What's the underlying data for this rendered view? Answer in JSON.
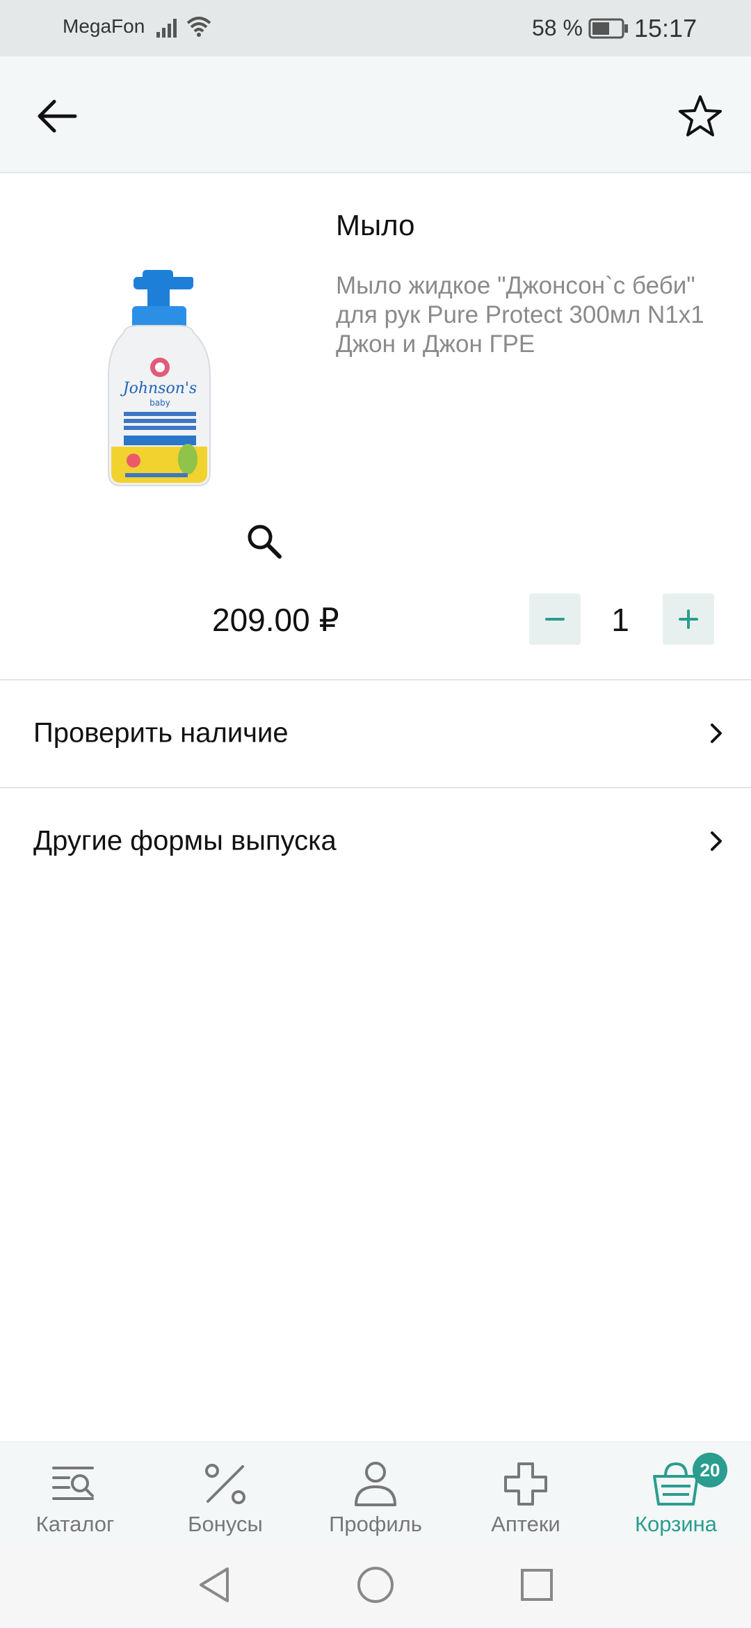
{
  "status_bar": {
    "carrier": "MegaFon",
    "battery_percent": "58 %",
    "time": "15:17"
  },
  "app_bar": {
    "back_icon": "arrow-left-icon",
    "favorite_icon": "star-outline-icon"
  },
  "product": {
    "title": "Мыло",
    "description": "Мыло жидкое \"Джонсон`с беби\" для рук Pure Protect 300мл N1x1 Джон и Джон ГРЕ",
    "image_icon": "product-bottle-image",
    "zoom_icon": "magnifier-icon",
    "price": "209.00 ₽",
    "quantity": "1",
    "minus_label": "−",
    "plus_label": "+"
  },
  "rows": [
    {
      "label": "Проверить наличие"
    },
    {
      "label": "Другие формы выпуска"
    }
  ],
  "bottom_nav": {
    "items": [
      {
        "label": "Каталог",
        "icon": "catalog-icon"
      },
      {
        "label": "Бонусы",
        "icon": "percent-icon"
      },
      {
        "label": "Профиль",
        "icon": "person-icon"
      },
      {
        "label": "Аптеки",
        "icon": "pharmacy-cross-icon"
      },
      {
        "label": "Корзина",
        "icon": "basket-icon"
      }
    ],
    "cart_badge": "20",
    "active_color": "#2a9d8f"
  }
}
